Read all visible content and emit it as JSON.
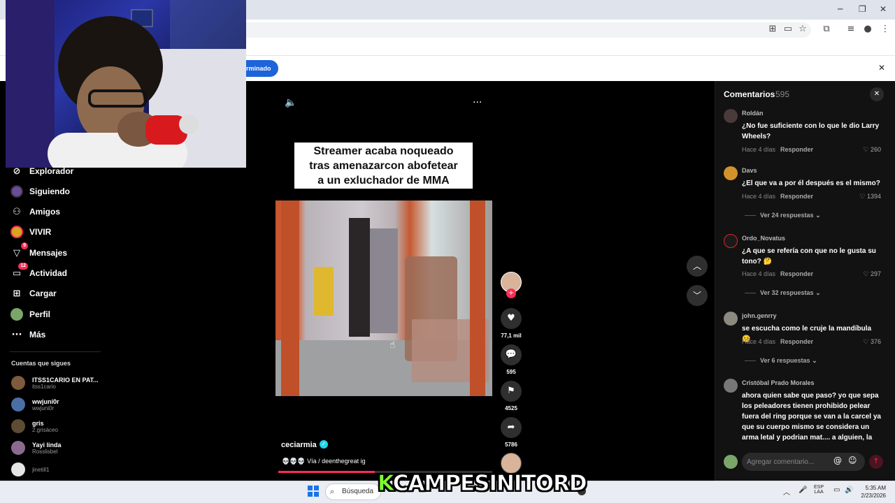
{
  "browser": {
    "banner_button": "rminado",
    "icons": [
      "translate-icon",
      "cast-icon",
      "star-icon",
      "extensions-icon",
      "reading-list-icon",
      "profile-icon",
      "kebab-menu-icon"
    ]
  },
  "sidebar": {
    "items": [
      {
        "label": "Explorador",
        "icon": "compass-icon"
      },
      {
        "label": "Siguiendo",
        "icon": "avatar-icon"
      },
      {
        "label": "Amigos",
        "icon": "people-icon"
      },
      {
        "label": "VIVIR",
        "icon": "live-icon"
      },
      {
        "label": "Mensajes",
        "icon": "send-icon",
        "badge": "9"
      },
      {
        "label": "Actividad",
        "icon": "inbox-icon",
        "badge": "12"
      },
      {
        "label": "Cargar",
        "icon": "plus-square-icon"
      },
      {
        "label": "Perfil",
        "icon": "avatar-icon"
      },
      {
        "label": "Más",
        "icon": "more-icon"
      }
    ],
    "following_title": "Cuentas que sigues",
    "following": [
      {
        "name": "ITSS1CARIO EN PAT...",
        "user": "itss1cario"
      },
      {
        "name": "wwjuni0r",
        "user": "wwjuni0r"
      },
      {
        "name": "gris",
        "user": "2.grisáceo"
      },
      {
        "name": "Yayi linda",
        "user": "Rosslisbel"
      },
      {
        "name": "",
        "user": "jinetill1"
      }
    ]
  },
  "video": {
    "caption": [
      "Streamer acaba noqueado",
      "tras amenazarcon abofetear",
      "a un exluchador de MMA"
    ],
    "author": "ceciarmia",
    "description": "💀💀💀 Vía / deenthegreat ig",
    "progress": 0.45,
    "actions": {
      "likes": "77,1 mil",
      "comments": "595",
      "saves": "4525",
      "shares": "5786"
    }
  },
  "comments": {
    "title": "Comentarios",
    "count": "595",
    "items": [
      {
        "user": "Roldán",
        "text": "¿No fue suficiente con lo que le dio Larry Wheels?",
        "date": "Hace 4 días",
        "reply": "Responder",
        "likes": "260",
        "more": ""
      },
      {
        "user": "Davs",
        "text": "¿El que va a por él después es el mismo?",
        "date": "Hace 4 días",
        "reply": "Responder",
        "likes": "1394",
        "more": "Ver 24 respuestas"
      },
      {
        "user": "Ordo_Novatus",
        "text": "¿A que se refería con que no le gusta su tono? 🤔",
        "date": "Hace 4 días",
        "reply": "Responder",
        "likes": "297",
        "more": "Ver 32 respuestas"
      },
      {
        "user": "john.genrry",
        "text": "se escucha como le cruje la mandíbula 🤒",
        "date": "Hace 4 días",
        "reply": "Responder",
        "likes": "376",
        "more": "Ver 6 respuestas"
      },
      {
        "user": "Cristóbal Prado Morales",
        "text": "ahora quien sabe que paso? yo que sepa los peleadores tienen prohibido pelear fuera del ring porque se van a la carcel ya que su cuerpo mismo se considera un arma letal y podrian mat.... a alguien, la"
      }
    ],
    "input_placeholder": "Agregar comentario..."
  },
  "taskbar": {
    "search": "Búsqueda",
    "overlay_k": "K",
    "overlay_name": "CAMPESINITORD",
    "lang": [
      "ESP",
      "LAA"
    ],
    "time": "5:35 AM",
    "date": "2/23/2026"
  }
}
